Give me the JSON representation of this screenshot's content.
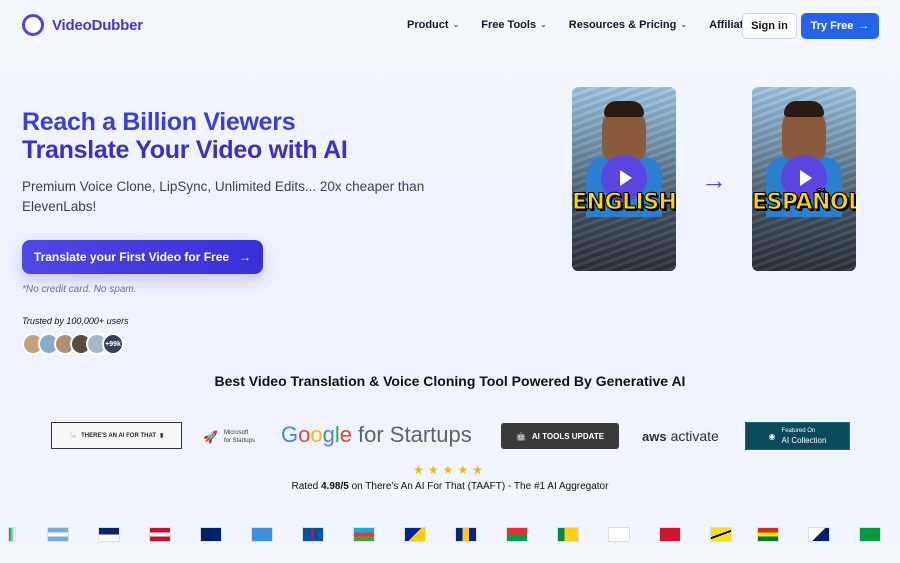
{
  "nav": {
    "logo_text": "VideoDubber",
    "menu": [
      {
        "label": "Product",
        "dropdown": true
      },
      {
        "label": "Free Tools",
        "dropdown": true
      },
      {
        "label": "Resources & Pricing",
        "dropdown": true
      },
      {
        "label": "Affiliates",
        "dropdown": false
      }
    ],
    "signin_label": "Sign in",
    "tryfree_label": "Try Free"
  },
  "hero": {
    "title_line1": "Reach a Billion Viewers",
    "title_line2": "Translate Your Video with AI",
    "subtitle": "Premium Voice Clone, LipSync, Unlimited Edits... 20x cheaper than ElevenLabs!",
    "cta_label": "Translate your First Video for Free",
    "note": "*No credit card. No spam.",
    "trusted": "Trusted by 100,000+ users",
    "avatar_more": "+99k"
  },
  "videos": [
    {
      "caption": "ENGLISH"
    },
    {
      "caption": "ESPAÑOL"
    }
  ],
  "section": {
    "powered_title": "Best Video Translation & Voice Cloning Tool Powered By Generative AI",
    "logos": {
      "taaft": "THERE'S AN AI FOR THAT",
      "ms_line1": "Microsoft",
      "ms_line2": "for Startups",
      "google": [
        "G",
        "o",
        "o",
        "g",
        "l",
        "e"
      ],
      "google_suffix": "for Startups",
      "aitools": "AI TOOLS UPDATE",
      "aws_brand": "aws",
      "aws_suffix": "activate",
      "aic_line1": "Featured On",
      "aic_line2": "AI Collection"
    },
    "stars": "★★★★★",
    "rated_prefix": "Rated ",
    "rated_score": "4.98/5",
    "rated_suffix": " on There's An AI For That (TAAFT) - The #1 AI Aggregator"
  },
  "colors": {
    "brand": "#4f46e5",
    "primary_button": "#2563eb",
    "heading": "#3b3fd8"
  },
  "icons": {
    "arrow_right": "→",
    "chevron_down": "⌄"
  }
}
